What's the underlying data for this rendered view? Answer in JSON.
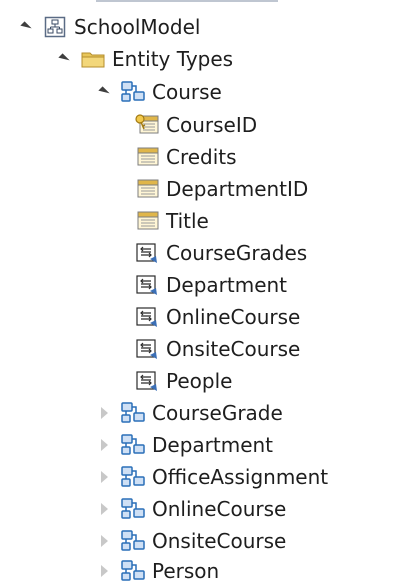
{
  "tree": {
    "root": {
      "label": "SchoolModel",
      "icon": "model-icon",
      "expanded": true
    },
    "entity_types": {
      "label": "Entity Types",
      "icon": "folder-icon",
      "expanded": true
    },
    "course": {
      "label": "Course",
      "icon": "entity-icon",
      "expanded": true,
      "properties": [
        {
          "label": "CourseID",
          "icon": "key-property-icon"
        },
        {
          "label": "Credits",
          "icon": "scalar-property-icon"
        },
        {
          "label": "DepartmentID",
          "icon": "scalar-property-icon"
        },
        {
          "label": "Title",
          "icon": "scalar-property-icon"
        }
      ],
      "navigation_properties": [
        {
          "label": "CourseGrades",
          "icon": "navigation-property-icon"
        },
        {
          "label": "Department",
          "icon": "navigation-property-icon"
        },
        {
          "label": "OnlineCourse",
          "icon": "navigation-property-icon"
        },
        {
          "label": "OnsiteCourse",
          "icon": "navigation-property-icon"
        },
        {
          "label": "People",
          "icon": "navigation-property-icon"
        }
      ]
    },
    "other_entities": [
      {
        "label": "CourseGrade",
        "icon": "entity-icon",
        "expanded": false
      },
      {
        "label": "Department",
        "icon": "entity-icon",
        "expanded": false
      },
      {
        "label": "OfficeAssignment",
        "icon": "entity-icon",
        "expanded": false
      },
      {
        "label": "OnlineCourse",
        "icon": "entity-icon",
        "expanded": false
      },
      {
        "label": "OnsiteCourse",
        "icon": "entity-icon",
        "expanded": false
      },
      {
        "label": "Person",
        "icon": "entity-icon",
        "expanded": false
      }
    ]
  },
  "colors": {
    "text": "#1e1e1e",
    "entity_blue": "#2a6fb8",
    "folder_yellow": "#e8c65a",
    "key_gold": "#d9a520",
    "nav_blue": "#3b6fb6"
  }
}
